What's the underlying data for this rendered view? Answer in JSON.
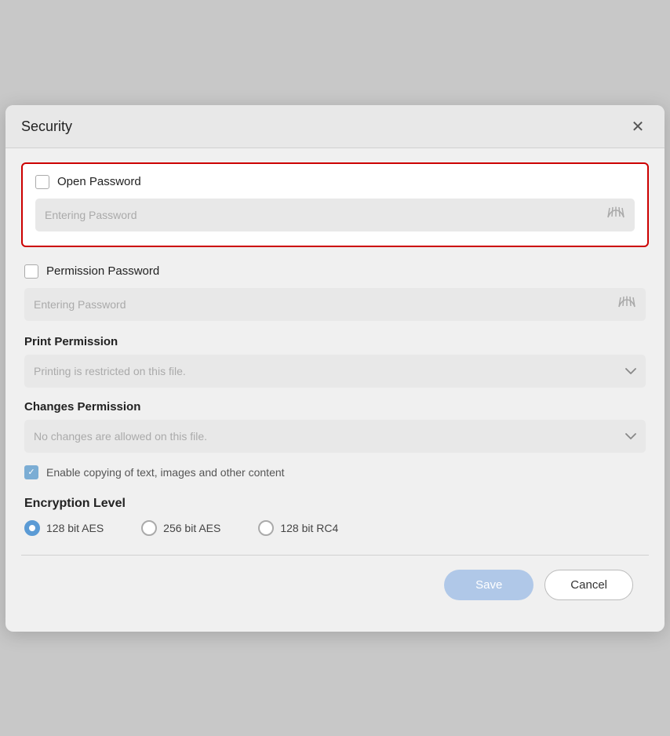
{
  "dialog": {
    "title": "Security",
    "close_label": "×"
  },
  "open_password": {
    "checkbox_label": "Open Password",
    "input_placeholder": "Entering Password",
    "checked": false
  },
  "permission_password": {
    "checkbox_label": "Permission Password",
    "input_placeholder": "Entering Password",
    "checked": false
  },
  "print_permission": {
    "label": "Print Permission",
    "value": "Printing is restricted on this file.",
    "placeholder": "Printing is restricted on this file."
  },
  "changes_permission": {
    "label": "Changes Permission",
    "value": "No changes are allowed on this file.",
    "placeholder": "No changes are allowed on this file."
  },
  "copy_content": {
    "label": "Enable copying of text, images and other content",
    "checked": true
  },
  "encryption": {
    "title": "Encryption Level",
    "options": [
      {
        "id": "aes128",
        "label": "128 bit AES",
        "selected": true
      },
      {
        "id": "aes256",
        "label": "256 bit AES",
        "selected": false
      },
      {
        "id": "rc4128",
        "label": "128 bit RC4",
        "selected": false
      }
    ]
  },
  "footer": {
    "save_label": "Save",
    "cancel_label": "Cancel"
  },
  "icons": {
    "eye": "眇",
    "chevron": "∨",
    "close": "✕"
  }
}
